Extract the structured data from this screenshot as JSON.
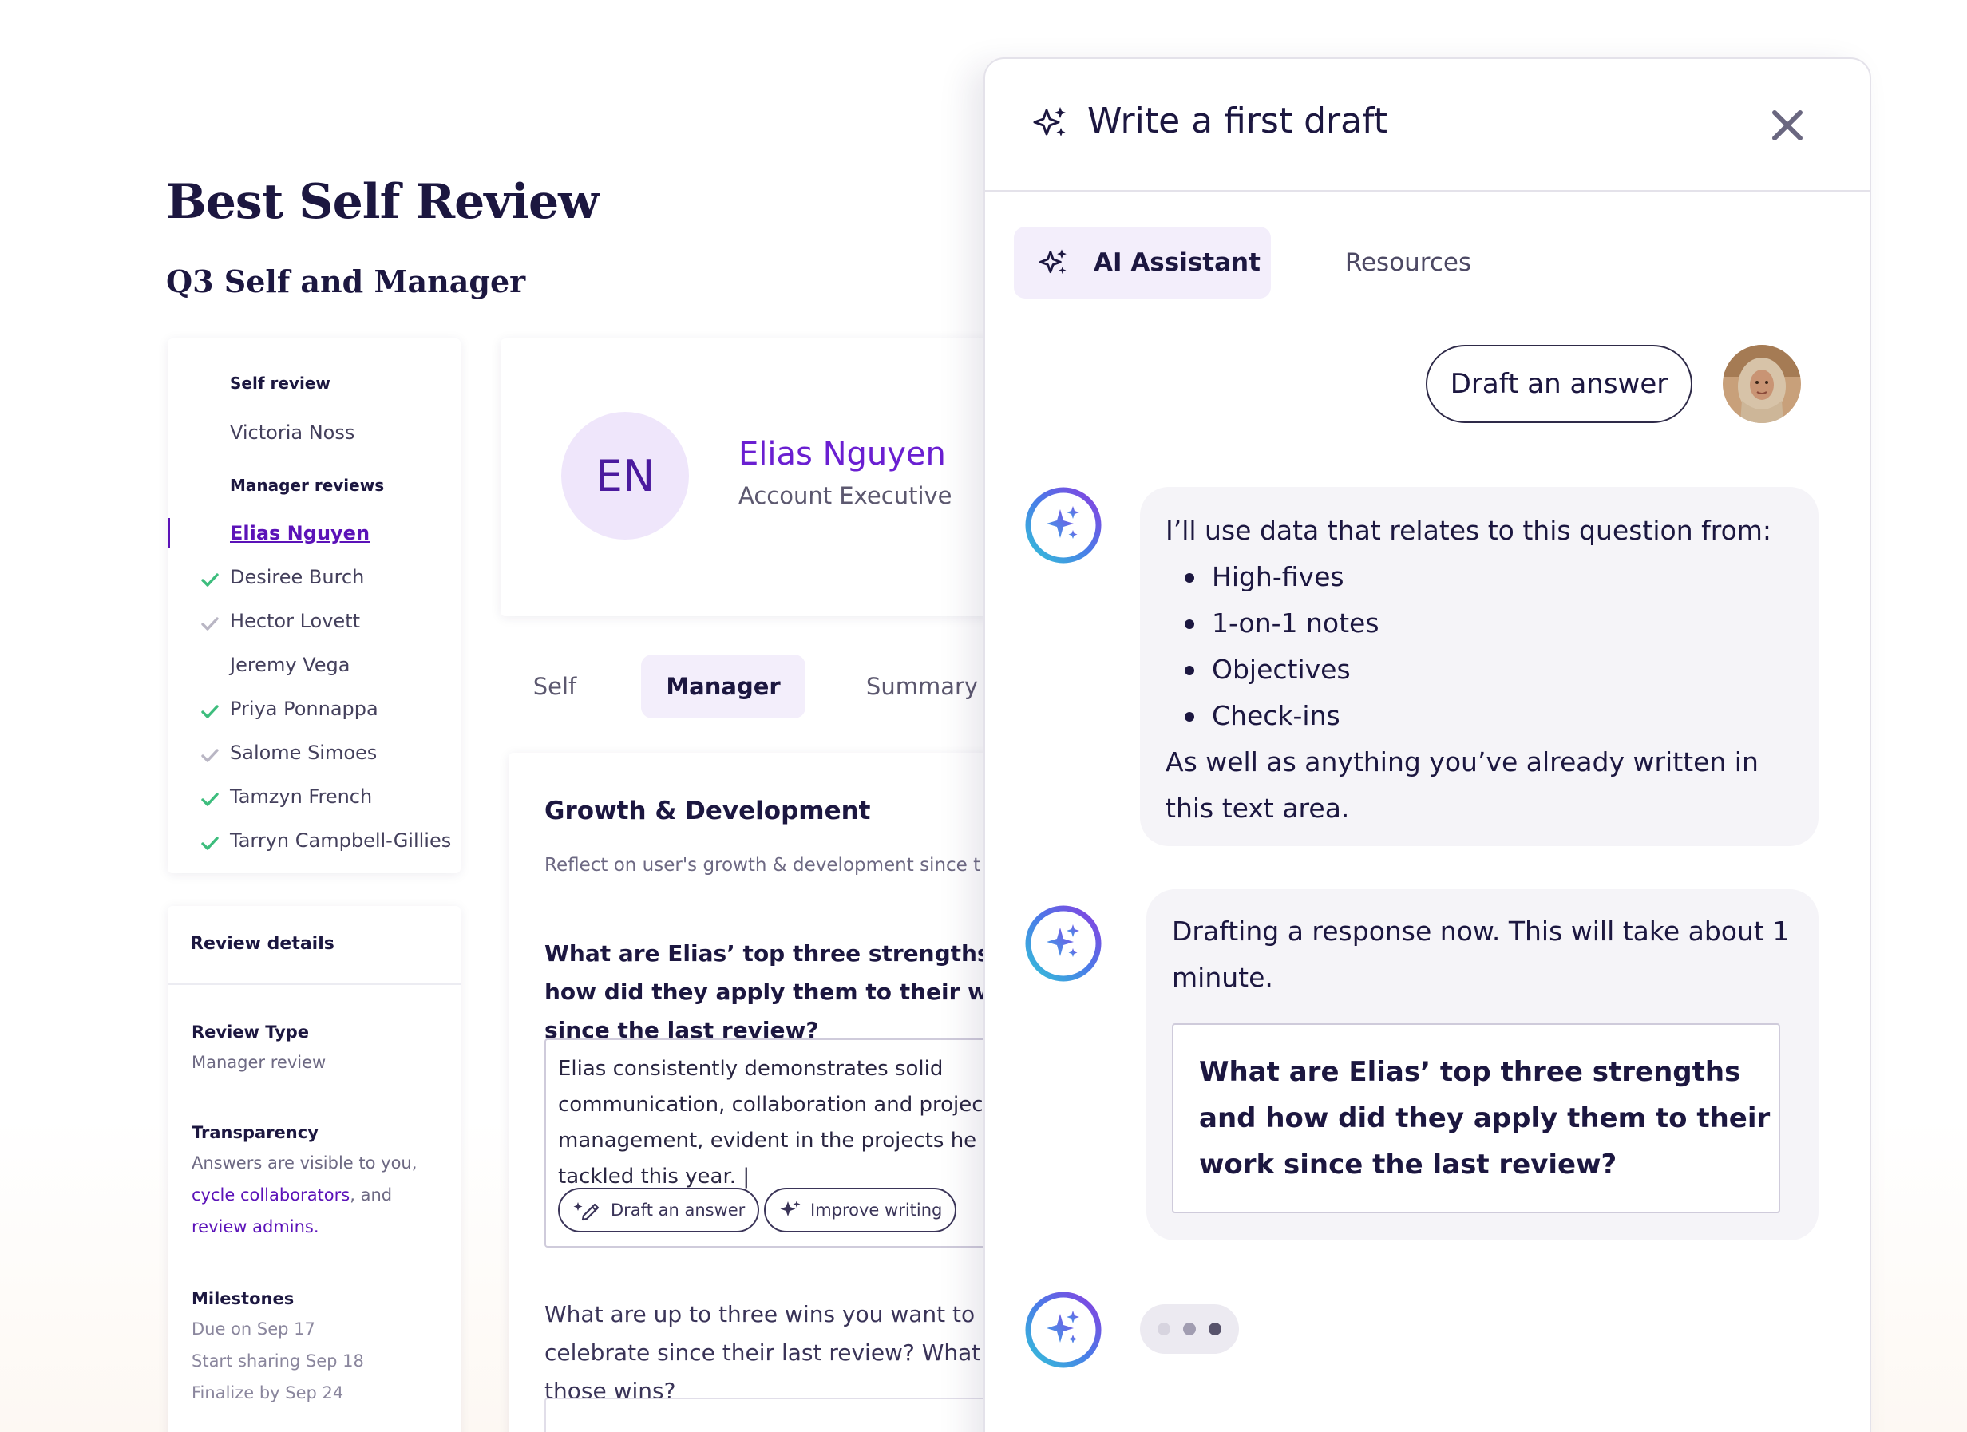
{
  "page": {
    "title": "Best Self Review",
    "subtitle": "Q3 Self and Manager"
  },
  "nav": {
    "self_section": "Self review",
    "self_name": "Victoria Noss",
    "manager_section": "Manager reviews",
    "items": [
      {
        "label": "Elias Nguyen",
        "status": "active"
      },
      {
        "label": "Desiree Burch",
        "status": "complete"
      },
      {
        "label": "Hector Lovett",
        "status": "partial"
      },
      {
        "label": "Jeremy Vega",
        "status": "none"
      },
      {
        "label": "Priya Ponnappa",
        "status": "complete"
      },
      {
        "label": "Salome Simoes",
        "status": "partial"
      },
      {
        "label": "Tamzyn French",
        "status": "complete"
      },
      {
        "label": "Tarryn Campbell-Gillies",
        "status": "complete"
      }
    ]
  },
  "details": {
    "heading": "Review details",
    "type_label": "Review Type",
    "type_value": "Manager review",
    "transparency_label": "Transparency",
    "transparency_text_1": "Answers are visible to you,",
    "transparency_link_1": "cycle collaborators",
    "transparency_text_2": ", and",
    "transparency_link_2": "review admins",
    "transparency_text_3": ".",
    "milestones_label": "Milestones",
    "milestones": [
      "Due on Sep 17",
      "Start sharing Sep 18",
      "Finalize by Sep 24"
    ]
  },
  "profile": {
    "initials": "EN",
    "name": "Elias Nguyen",
    "role": "Account Executive"
  },
  "tabs": [
    "Self",
    "Manager",
    "Summary"
  ],
  "question": {
    "title": "Growth & Development",
    "description": "Reflect on user's growth & development since t",
    "prompt": "What are Elias’ top three strengths and how did they apply them to their work since the last review?",
    "answer": "Elias consistently demonstrates solid communication, collaboration and project management, evident in the projects he tackled this year. |",
    "draft_button": "Draft an answer",
    "improve_button": "Improve writing",
    "prompt_2": "What are up to three wins you want to celebrate since their last review? What led to those wins?"
  },
  "ai_panel": {
    "title": "Write a first draft",
    "tab_assistant": "AI Assistant",
    "tab_resources": "Resources",
    "user_message": "Draft an answer",
    "bot_message_1_intro": "I’ll use data that relates to this question from:",
    "bot_message_1_items": [
      "High-fives",
      "1-on-1 notes",
      "Objectives",
      "Check-ins"
    ],
    "bot_message_1_outro": "As well as anything you’ve already written in this text area.",
    "bot_message_2": "Drafting a response now. This will take about 1 minute.",
    "bot_message_2_question": "What are Elias’ top three strengths and how did they apply them to their work since the last review?"
  },
  "colors": {
    "accent": "#5b12b8",
    "check_complete": "#3dbd7d",
    "check_partial": "#b9b6c4",
    "ink": "#1c1740"
  }
}
